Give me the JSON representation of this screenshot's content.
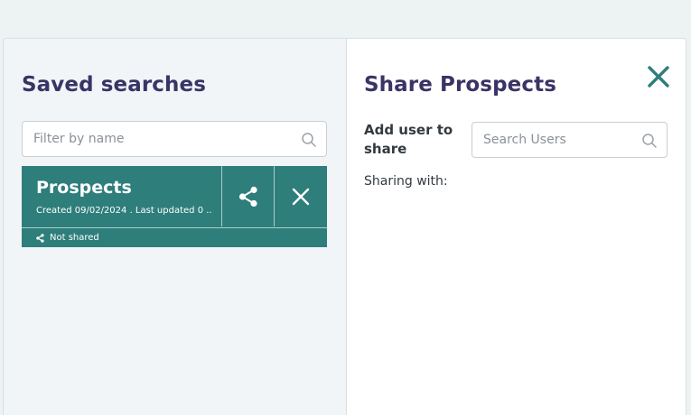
{
  "saved_searches": {
    "title": "Saved searches",
    "filter_placeholder": "Filter by name",
    "items": [
      {
        "name": "Prospects",
        "meta": "Created 09/02/2024 . Last updated 0 ...",
        "share_status": "Not shared"
      }
    ]
  },
  "share_panel": {
    "title": "Share Prospects",
    "add_user_label": "Add user to share",
    "search_placeholder": "Search Users",
    "sharing_with_label": "Sharing with:"
  },
  "colors": {
    "accent": "#2e7e7b",
    "title": "#3a3466",
    "background": "#edf3f3"
  },
  "icons": {
    "filter_search": "search-icon",
    "users_search": "search-icon",
    "share": "share-icon",
    "delete": "close-icon",
    "status": "share-icon",
    "close_panel": "close-icon"
  }
}
